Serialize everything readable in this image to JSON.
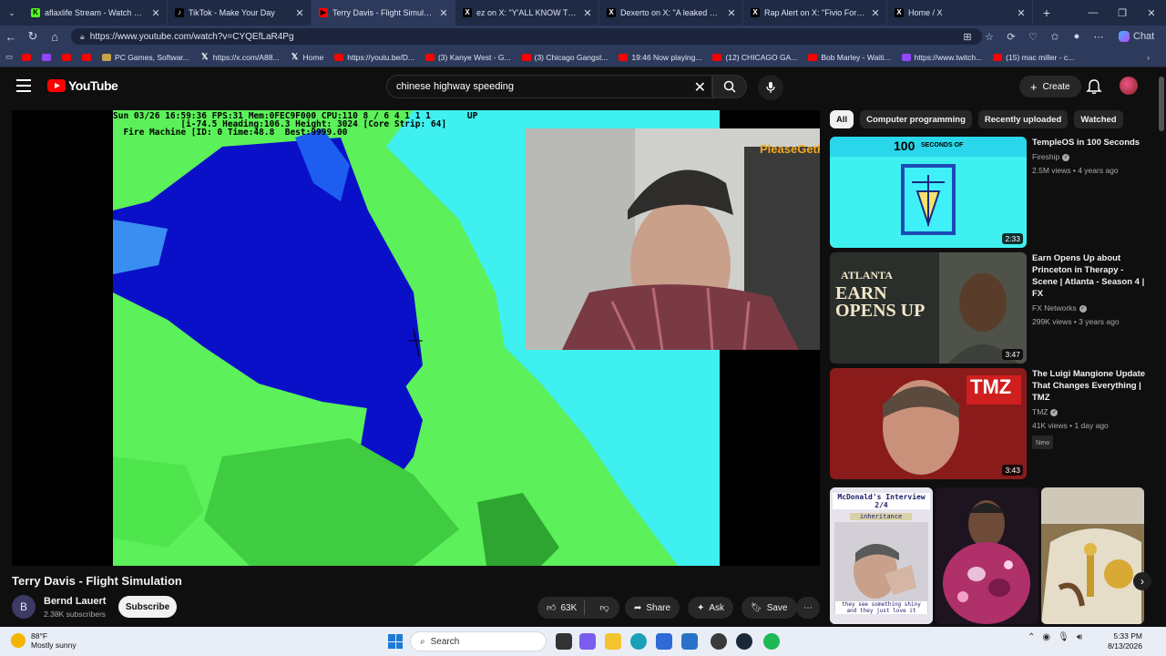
{
  "browser": {
    "tabs": [
      {
        "title": "aflaxlife Stream - Watch Live on K",
        "favicon": "kick",
        "color": "#53fc18",
        "glyph": "K"
      },
      {
        "title": "TikTok - Make Your Day",
        "favicon": "tiktok",
        "color": "#000000",
        "glyph": "♪"
      },
      {
        "title": "Terry Davis - Flight Simulation",
        "favicon": "youtube",
        "color": "#ff0000",
        "glyph": "▶",
        "active": true
      },
      {
        "title": "ez on X: \"Y'ALL KNOW THE DRILL\"",
        "favicon": "x",
        "color": "#000000",
        "glyph": "X"
      },
      {
        "title": "Dexerto on X: \"A leaked screensho",
        "favicon": "x",
        "color": "#000000",
        "glyph": "X"
      },
      {
        "title": "Rap Alert on X: \"Fivio Foreign dro",
        "favicon": "x",
        "color": "#000000",
        "glyph": "X"
      },
      {
        "title": "Home / X",
        "favicon": "x",
        "color": "#000000",
        "glyph": "X"
      }
    ],
    "url": "https://www.youtube.com/watch?v=CYQEfLaR4Pg",
    "copilot_label": "Chat",
    "bookmarks": [
      {
        "label": "",
        "icon": "youtube"
      },
      {
        "label": "",
        "icon": "twitch"
      },
      {
        "label": "",
        "icon": "youtube"
      },
      {
        "label": "",
        "icon": "youtube"
      },
      {
        "label": "PC Games, Softwar...",
        "icon": "pcgames"
      },
      {
        "label": "https://x.com/A88...",
        "icon": "x"
      },
      {
        "label": "Home",
        "icon": "x"
      },
      {
        "label": "https://youtu.be/D...",
        "icon": "youtube"
      },
      {
        "label": "(3) Kanye West - G...",
        "icon": "youtube"
      },
      {
        "label": "(3) Chicago Gangst...",
        "icon": "youtube"
      },
      {
        "label": "19:46 Now playing...",
        "icon": "youtube"
      },
      {
        "label": "(12) CHICAGO GA...",
        "icon": "youtube"
      },
      {
        "label": "Bob Marley - Waiti...",
        "icon": "youtube"
      },
      {
        "label": "https://www.twitch...",
        "icon": "twitch"
      },
      {
        "label": "(15) mac miller - c...",
        "icon": "youtube"
      }
    ]
  },
  "youtube": {
    "logo_text": "YouTube",
    "search_query": "chinese highway speeding",
    "create_label": "Create",
    "video": {
      "title": "Terry Davis - Flight Simulation",
      "osd_line1": "Sun 03/26 16:59:36 FPS:31 Mem:0FEC9F000 CPU:110 8 / 6 4 1 1 1       UP",
      "osd_line2": "             [i-74.5 Heading:106.3 Height: 3024 [Core Strip: 64]",
      "osd_line3": "  Fire Machine [ID: 0 Time:48.8  Best:9999.00",
      "overlay": "PleaseGetHelp:"
    },
    "channel": {
      "avatar_letter": "B",
      "name": "Bernd Lauert",
      "subscribers": "2.38K subscribers",
      "subscribe_label": "Subscribe"
    },
    "actions": {
      "likes": "63K",
      "share": "Share",
      "ask": "Ask",
      "save": "Save"
    },
    "chips": [
      "All",
      "Computer programming",
      "Recently uploaded",
      "Watched"
    ],
    "recommendations": [
      {
        "title": "TempleOS in 100 Seconds",
        "channel": "Fireship",
        "views": "2.5M views • 4 years ago",
        "duration": "2:33",
        "thumb_text": "100",
        "thumb_sub": "SECONDS OF"
      },
      {
        "title": "Earn Opens Up about Princeton in Therapy - Scene | Atlanta - Season 4 | FX",
        "channel": "FX Networks",
        "views": "299K views • 3 years ago",
        "duration": "3:47",
        "thumb_text": "EARN OPENS UP",
        "thumb_sub": "ATLANTA"
      },
      {
        "title": "The Luigi Mangione Update That Changes Everything | TMZ",
        "channel": "TMZ",
        "views": "41K views • 1 day ago",
        "duration": "3:43",
        "badge": "New",
        "thumb_text": "TMZ"
      }
    ],
    "shorts": [
      {
        "caption_top": "McDonald's Interview 2/4",
        "caption_tag": "inheritance",
        "caption_bottom": "they see something shiny and they just love it"
      },
      {},
      {}
    ]
  },
  "taskbar": {
    "weather_temp": "88°F",
    "weather_desc": "Mostly sunny",
    "search_label": "Search",
    "time": "5:33 PM",
    "date": "8/13/2026"
  }
}
